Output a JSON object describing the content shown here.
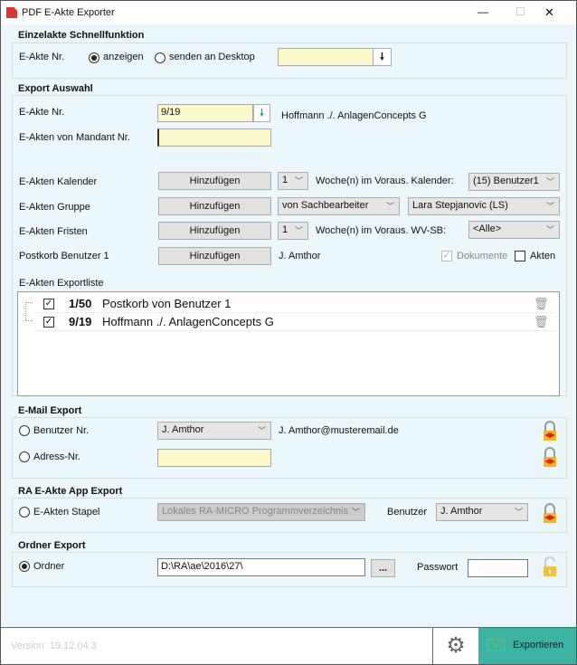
{
  "window": {
    "title": "PDF E-Akte Exporter",
    "minimize": "—",
    "maximize": "☐",
    "close": "✕"
  },
  "quick": {
    "header": "Einzelakte Schnellfunktion",
    "label": "E-Akte Nr.",
    "radio1": "anzeigen",
    "radio2": "senden an Desktop",
    "value": "",
    "arrow": "🠗"
  },
  "export": {
    "header": "Export Auswahl",
    "akte_label": "E-Akte Nr.",
    "akte_value": "9/19",
    "akte_name": "Hoffmann ./. AnlagenConcepts G",
    "mandant_label": "E-Akten von Mandant Nr.",
    "mandant_value": "",
    "kalender": {
      "label": "E-Akten Kalender",
      "button": "Hinzufügen",
      "weeks": "1",
      "text": "Woche(n) im Voraus. Kalender:",
      "select": "(15) Benutzer1"
    },
    "gruppe": {
      "label": "E-Akten Gruppe",
      "button": "Hinzufügen",
      "select1": "von Sachbearbeiter",
      "select2": "Lara Stepjanovic (LS)"
    },
    "fristen": {
      "label": "E-Akten Fristen",
      "button": "Hinzufügen",
      "weeks": "1",
      "text": "Woche(n) im Voraus. WV-SB:",
      "select": "<Alle>"
    },
    "postkorb": {
      "label": "Postkorb Benutzer 1",
      "button": "Hinzufügen",
      "user": "J. Amthor",
      "dokumente": "Dokumente",
      "akten": "Akten",
      "dokumente_checked": true,
      "akten_checked": false
    },
    "list_label": "E-Akten Exportliste",
    "list": [
      {
        "nr": "1/50",
        "name": "Postkorb von Benutzer 1",
        "checked": true
      },
      {
        "nr": "9/19",
        "name": "Hoffmann ./. AnlagenConcepts G",
        "checked": true
      }
    ]
  },
  "email": {
    "header": "E-Mail Export",
    "benutzer_label": "Benutzer Nr.",
    "benutzer_select": "J. Amthor",
    "email": "J. Amthor@musteremail.de",
    "adress_label": "Adress-Nr.",
    "adress_value": ""
  },
  "app": {
    "header": "RA E-Akte App Export",
    "stapel_label": "E-Akten Stapel",
    "stapel_select": "Lokales RA-MICRO Programmverzeichnis",
    "benutzer_label": "Benutzer",
    "benutzer_select": "J. Amthor"
  },
  "ordner": {
    "header": "Ordner Export",
    "label": "Ordner",
    "path": "D:\\RA\\ae\\2016\\27\\",
    "browse": "...",
    "passwort_label": "Passwort",
    "passwort": ""
  },
  "footer": {
    "version": "Version: 19.12.04.3",
    "export": "Exportieren",
    "accent": "#3db3a1"
  }
}
